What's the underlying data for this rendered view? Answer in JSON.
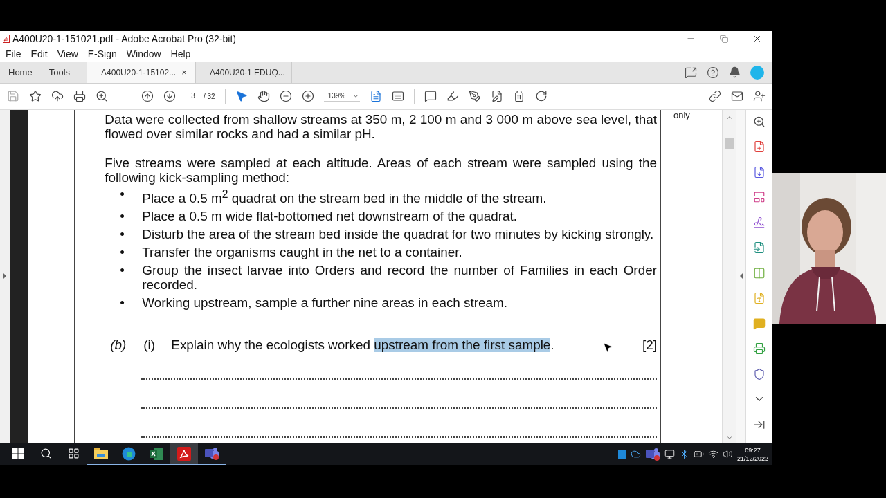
{
  "window": {
    "title": "A400U20-1-151021.pdf - Adobe Acrobat Pro (32-bit)"
  },
  "menu": [
    "File",
    "Edit",
    "View",
    "E-Sign",
    "Window",
    "Help"
  ],
  "nav_tabs": [
    {
      "label": "Home",
      "selected": false
    },
    {
      "label": "Tools",
      "selected": false
    }
  ],
  "doc_tabs": [
    {
      "label": "A400U20-1-15102...",
      "selected": true,
      "close": "×"
    },
    {
      "label": "A400U20-1 EDUQ...",
      "selected": false
    }
  ],
  "toolbar": {
    "page": "3",
    "page_count": "/ 32",
    "zoom": "139%"
  },
  "document": {
    "margin_note": "only",
    "blocks": [
      {
        "kind": "paragraph",
        "text": "Data were collected from shallow streams at 350 m, 2 100 m and 3 000 m above sea level, that flowed over similar rocks and had a similar pH."
      },
      {
        "kind": "paragraph",
        "text": "Five streams were sampled at each altitude. Areas of each stream were sampled using the following kick-sampling method:"
      },
      {
        "kind": "list",
        "items": [
          {
            "bullet": "•",
            "text": "Place a 0.5 m$^{2}$ quadrat on the stream bed in the middle of the stream."
          },
          {
            "bullet": "•",
            "text": "Place a 0.5 m wide flat-bottomed net downstream of the quadrat."
          },
          {
            "bullet": "•",
            "text": "Disturb the area of the stream bed inside the quadrat for two minutes by kicking strongly."
          },
          {
            "bullet": "•",
            "text": "Transfer the organisms caught in the net to a container."
          },
          {
            "bullet": "•",
            "text": "Group the insect larvae into Orders and record the number of Families in each Order recorded."
          },
          {
            "bullet": "•",
            "text": "Working upstream, sample a further nine areas in each stream."
          }
        ]
      }
    ],
    "question": {
      "part": "(b)",
      "subpart": "(i)",
      "parts": [
        {
          "text": "Explain why the ecologists worked ",
          "highlighted": false
        },
        {
          "text": "upstream from the first sample",
          "highlighted": true
        },
        {
          "text": ".",
          "highlighted": false
        }
      ],
      "marks": "[2]"
    }
  },
  "taskbar": {
    "apps": [
      {
        "kind": "files",
        "active": false
      },
      {
        "kind": "browser",
        "active": false
      },
      {
        "kind": "spreadsheet",
        "active": false
      },
      {
        "kind": "pdf",
        "active": true
      },
      {
        "kind": "chat",
        "active": false
      }
    ],
    "time": "09:27",
    "date": "21/12/2022"
  }
}
